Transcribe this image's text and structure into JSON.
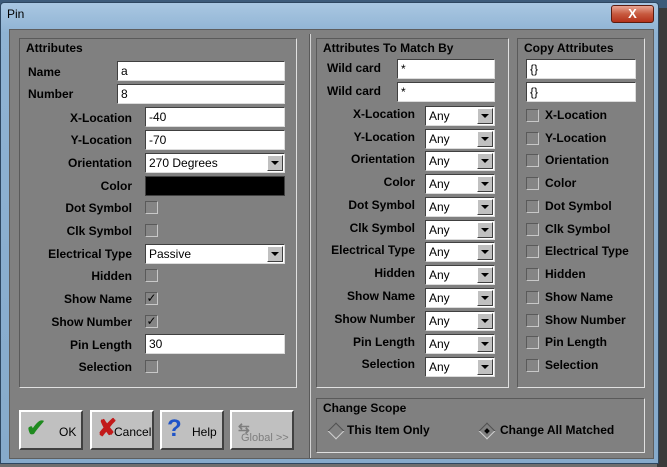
{
  "window": {
    "title": "Pin",
    "close_label": "X"
  },
  "attributes": {
    "title": "Attributes",
    "name_label": "Name",
    "name_value": "a",
    "number_label": "Number",
    "number_value": "8",
    "xloc_label": "X-Location",
    "xloc_value": "-40",
    "yloc_label": "Y-Location",
    "yloc_value": "-70",
    "orientation_label": "Orientation",
    "orientation_value": "270 Degrees",
    "color_label": "Color",
    "color_value": "#000000",
    "dot_label": "Dot Symbol",
    "clk_label": "Clk Symbol",
    "etype_label": "Electrical Type",
    "etype_value": "Passive",
    "hidden_label": "Hidden",
    "showname_label": "Show Name",
    "shownumber_label": "Show Number",
    "pinlength_label": "Pin Length",
    "pinlength_value": "30",
    "selection_label": "Selection"
  },
  "match": {
    "title": "Attributes To Match By",
    "wild1_label": "Wild card",
    "wild1_value": "*",
    "wild2_label": "Wild card",
    "wild2_value": "*",
    "rows": [
      {
        "label": "X-Location",
        "value": "Any"
      },
      {
        "label": "Y-Location",
        "value": "Any"
      },
      {
        "label": "Orientation",
        "value": "Any"
      },
      {
        "label": "Color",
        "value": "Any"
      },
      {
        "label": "Dot Symbol",
        "value": "Any"
      },
      {
        "label": "Clk Symbol",
        "value": "Any"
      },
      {
        "label": "Electrical Type",
        "value": "Any"
      },
      {
        "label": "Hidden",
        "value": "Any"
      },
      {
        "label": "Show Name",
        "value": "Any"
      },
      {
        "label": "Show Number",
        "value": "Any"
      },
      {
        "label": "Pin Length",
        "value": "Any"
      },
      {
        "label": "Selection",
        "value": "Any"
      }
    ]
  },
  "copy": {
    "title": "Copy Attributes",
    "field1_value": "{}",
    "field2_value": "{}",
    "items": [
      "X-Location",
      "Y-Location",
      "Orientation",
      "Color",
      "Dot Symbol",
      "Clk Symbol",
      "Electrical Type",
      "Hidden",
      "Show Name",
      "Show Number",
      "Pin Length",
      "Selection"
    ]
  },
  "scope": {
    "title": "Change Scope",
    "option1": "This Item Only",
    "option2": "Change All Matched",
    "selected": "Change All Matched"
  },
  "buttons": {
    "ok": "OK",
    "cancel": "Cancel",
    "help": "Help",
    "global": "Global >>"
  },
  "checks": {
    "show_name": "✓",
    "show_number": "✓"
  },
  "icons": {
    "ok": "check-icon",
    "cancel": "x-icon",
    "help": "question-icon",
    "global": "global-icon"
  }
}
